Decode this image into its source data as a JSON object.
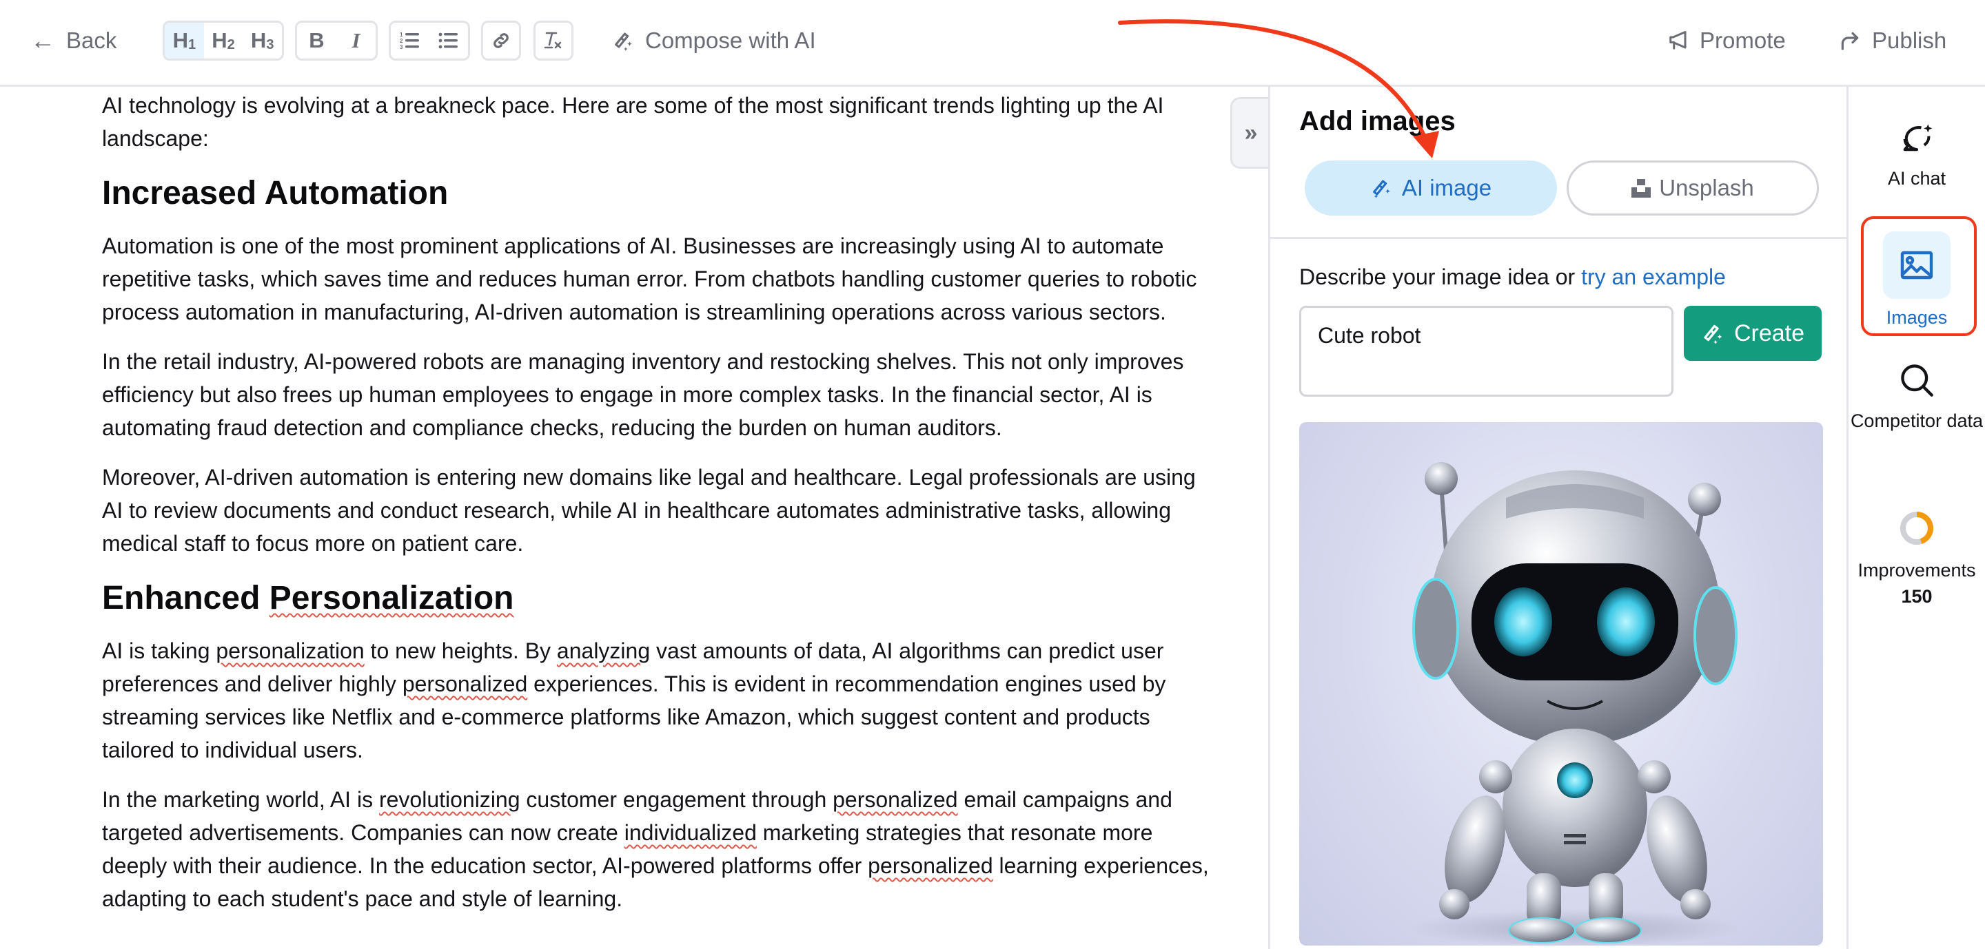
{
  "toolbar": {
    "back_label": "Back",
    "heading_buttons": [
      {
        "label": "H",
        "sub": "1",
        "active": true
      },
      {
        "label": "H",
        "sub": "2",
        "active": false
      },
      {
        "label": "H",
        "sub": "3",
        "active": false
      }
    ],
    "bold_label": "B",
    "italic_label": "I",
    "compose_label": "Compose with AI",
    "promote_label": "Promote",
    "publish_label": "Publish"
  },
  "editor": {
    "intro": "AI technology is evolving at a breakneck pace. Here are some of the most significant trends lighting up the AI landscape:",
    "sections": [
      {
        "heading": "Increased Automation",
        "paragraphs": [
          "Automation is one of the most prominent applications of AI. Businesses are increasingly using AI to automate repetitive tasks, which saves time and reduces human error. From chatbots handling customer queries to robotic process automation in manufacturing, AI-driven automation is streamlining operations across various sectors.",
          "In the retail industry, AI-powered robots are managing inventory and restocking shelves. This not only improves efficiency but also frees up human employees to engage in more complex tasks. In the financial sector, AI is automating fraud detection and compliance checks, reducing the burden on human auditors.",
          "Moreover, AI-driven automation is entering new domains like legal and healthcare. Legal professionals are using AI to review documents and conduct research, while AI in healthcare automates administrative tasks, allowing medical staff to focus more on patient care."
        ]
      },
      {
        "heading": "Enhanced Personalization",
        "paragraphs": [
          "AI is taking personalization to new heights. By analyzing vast amounts of data, AI algorithms can predict user preferences and deliver highly personalized experiences. This is evident in recommendation engines used by streaming services like Netflix and e-commerce platforms like Amazon, which suggest content and products tailored to individual users.",
          "In the marketing world, AI is revolutionizing customer engagement through personalized email campaigns and targeted advertisements. Companies can now create individualized marketing strategies that resonate more deeply with their audience. In the education sector, AI-powered platforms offer personalized learning experiences, adapting to each student's pace and style of learning."
        ]
      }
    ],
    "spellcheck_flagged_words": [
      "Personalization",
      "personalization",
      "analyzing",
      "personalized",
      "revolutionizing",
      "individualized"
    ],
    "collapse_icon": "double-chevron-right-icon"
  },
  "panel": {
    "title": "Add images",
    "tabs": [
      {
        "label": "AI image",
        "icon": "magic-wand-icon",
        "active": true
      },
      {
        "label": "Unsplash",
        "icon": "unsplash-icon",
        "active": false
      }
    ],
    "describe_text": "Describe your image idea or ",
    "describe_link": "try an example",
    "prompt_value": "Cute robot",
    "create_label": "Create",
    "result_image_alt": "Generated image of a cute silver robot"
  },
  "right_sidebar": {
    "items": [
      {
        "label": "AI chat",
        "icon": "chat-sparkle-icon",
        "active": false
      },
      {
        "label": "Images",
        "icon": "image-icon",
        "active": true
      },
      {
        "label": "Competitor data",
        "icon": "search-icon",
        "active": false
      },
      {
        "label": "Improvements",
        "icon": "progress-ring-icon",
        "count": "150",
        "progress": 0.45,
        "active": false
      }
    ]
  },
  "colors": {
    "accent_blue": "#1f6dc4",
    "active_tab_bg": "#d3ecfb",
    "create_green": "#139c7d",
    "annotation_red": "#f0391a",
    "progress_orange": "#f09a0c",
    "progress_track": "#cfd1d6"
  }
}
